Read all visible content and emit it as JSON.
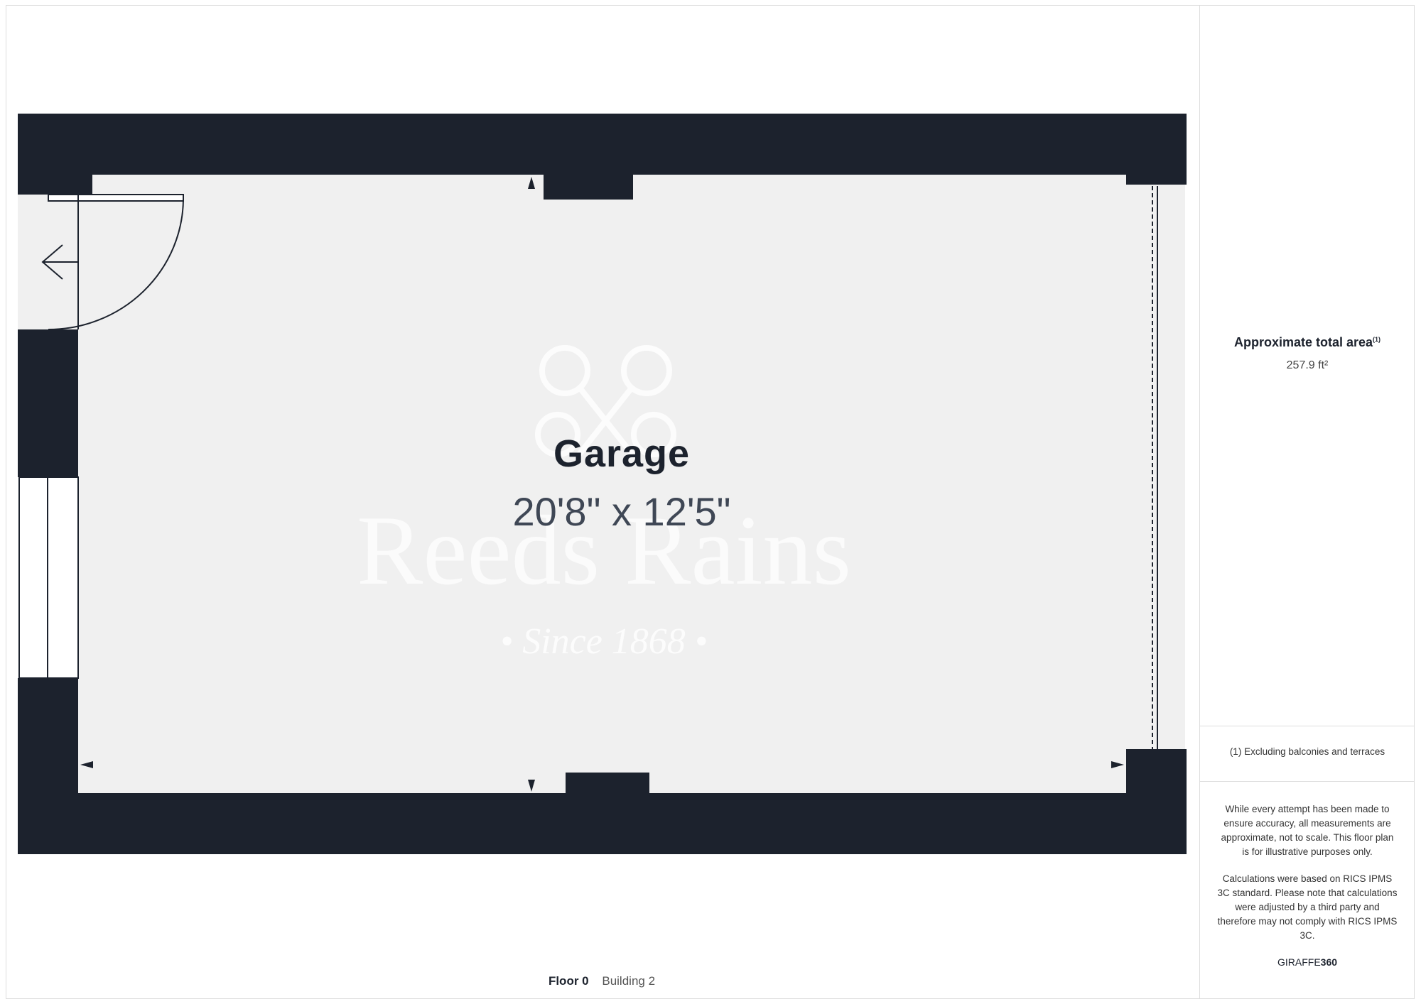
{
  "room": {
    "name": "Garage",
    "dimensions": "20'8\" x 12'5\""
  },
  "watermark": {
    "name": "Reeds Rains",
    "since": "• Since 1868 •"
  },
  "floor": {
    "label": "Floor 0",
    "building": "Building 2"
  },
  "sidebar": {
    "area_title": "Approximate total area",
    "area_note_marker": "(1)",
    "area_value": "257.9 ft²",
    "footnote": "(1) Excluding balconies and terraces",
    "disclaimer_1": "While every attempt has been made to ensure accuracy, all measurements are approximate, not to scale. This floor plan is for illustrative purposes only.",
    "disclaimer_2": "Calculations were based on RICS IPMS 3C standard. Please note that calculations were adjusted by a third party and therefore may not comply with RICS IPMS 3C.",
    "brand_prefix": "GIRAFFE",
    "brand_suffix": "360"
  },
  "colors": {
    "wall": "#1c222d",
    "floor": "#f0f0f0",
    "border": "#dcdcdc"
  },
  "icons": [
    "arrow-left-icon",
    "keys-logo-icon",
    "dimension-arrow-icon"
  ]
}
